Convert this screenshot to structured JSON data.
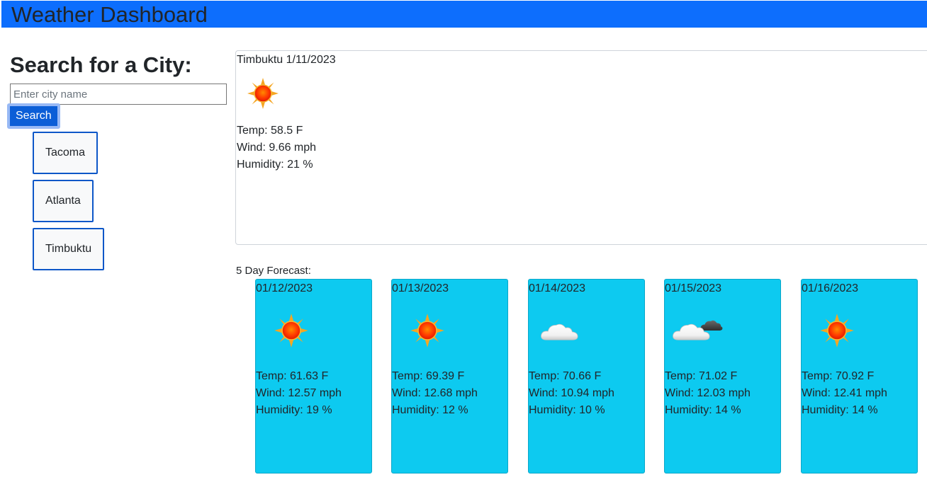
{
  "header": {
    "title": "Weather Dashboard"
  },
  "search": {
    "heading": "Search for a City:",
    "placeholder": "Enter city name",
    "value": "",
    "button_label": "Search"
  },
  "history": [
    {
      "label": "Tacoma"
    },
    {
      "label": "Atlanta"
    },
    {
      "label": "Timbuktu"
    }
  ],
  "current": {
    "title": "Timbuktu 1/11/2023",
    "icon": "sun-icon",
    "temp": "Temp: 58.5 F",
    "wind": "Wind: 9.66 mph",
    "humidity": "Humidity: 21 %"
  },
  "forecast": {
    "label": "5 Day Forecast:",
    "days": [
      {
        "date": "01/12/2023",
        "icon": "sun-icon",
        "temp": "Temp: 61.63 F",
        "wind": "Wind: 12.57 mph",
        "humidity": "Humidity: 19 %"
      },
      {
        "date": "01/13/2023",
        "icon": "sun-icon",
        "temp": "Temp: 69.39 F",
        "wind": "Wind: 12.68 mph",
        "humidity": "Humidity: 12 %"
      },
      {
        "date": "01/14/2023",
        "icon": "cloud-icon",
        "temp": "Temp: 70.66 F",
        "wind": "Wind: 10.94 mph",
        "humidity": "Humidity: 10 %"
      },
      {
        "date": "01/15/2023",
        "icon": "broken-clouds-icon",
        "temp": "Temp: 71.02 F",
        "wind": "Wind: 12.03 mph",
        "humidity": "Humidity: 14 %"
      },
      {
        "date": "01/16/2023",
        "icon": "sun-icon",
        "temp": "Temp: 70.92 F",
        "wind": "Wind: 12.41 mph",
        "humidity": "Humidity: 14 %"
      }
    ]
  },
  "colors": {
    "header_bg": "#0d6efd",
    "card_bg": "#0dcaf0",
    "search_button": "#0b5ed7",
    "history_border": "#0d57c8"
  }
}
